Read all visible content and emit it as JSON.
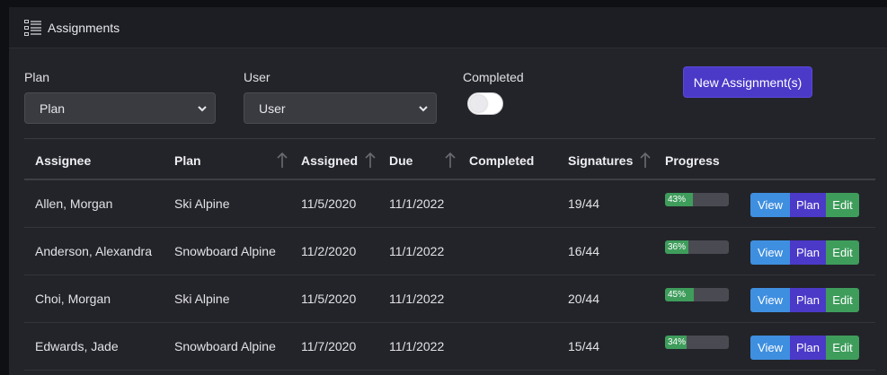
{
  "header": {
    "title": "Assignments",
    "icon": "list-icon"
  },
  "filters": {
    "plan_label": "Plan",
    "plan_value": "Plan",
    "user_label": "User",
    "user_value": "User",
    "completed_label": "Completed",
    "completed_on": false
  },
  "new_button": "New Assignment(s)",
  "table": {
    "columns": [
      "Assignee",
      "Plan",
      "Assigned",
      "Due",
      "Completed",
      "Signatures",
      "Progress"
    ],
    "rows": [
      {
        "assignee": "Allen, Morgan",
        "plan": "Ski Alpine",
        "assigned": "11/5/2020",
        "due": "11/1/2022",
        "completed": "",
        "signatures": "19/44",
        "progress": 43,
        "progress_label": "43%"
      },
      {
        "assignee": "Anderson, Alexandra",
        "plan": "Snowboard Alpine",
        "assigned": "11/2/2020",
        "due": "11/1/2022",
        "completed": "",
        "signatures": "16/44",
        "progress": 36,
        "progress_label": "36%"
      },
      {
        "assignee": "Choi, Morgan",
        "plan": "Ski Alpine",
        "assigned": "11/5/2020",
        "due": "11/1/2022",
        "completed": "",
        "signatures": "20/44",
        "progress": 45,
        "progress_label": "45%"
      },
      {
        "assignee": "Edwards, Jade",
        "plan": "Snowboard Alpine",
        "assigned": "11/7/2020",
        "due": "11/1/2022",
        "completed": "",
        "signatures": "15/44",
        "progress": 34,
        "progress_label": "34%"
      }
    ]
  },
  "row_actions": {
    "view": "View",
    "plan": "Plan",
    "edit": "Edit"
  },
  "colors": {
    "accent": "#4b39c8",
    "view": "#3f8fe0",
    "success": "#3f9d5c",
    "background": "#232429"
  }
}
